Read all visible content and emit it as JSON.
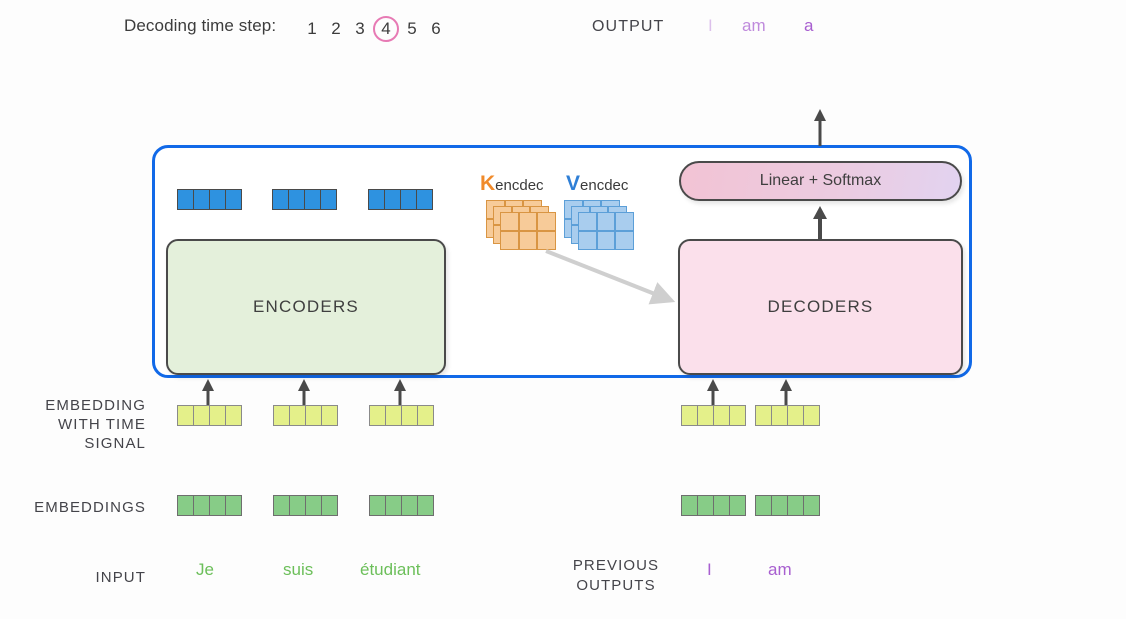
{
  "header": {
    "timestep_label": "Decoding time step:",
    "steps": [
      "1",
      "2",
      "3",
      "4",
      "5",
      "6"
    ],
    "active_step": "4",
    "output_label": "OUTPUT",
    "output_words": [
      {
        "text": "I",
        "opacity": 0.38
      },
      {
        "text": "am",
        "opacity": 0.72
      },
      {
        "text": "a",
        "opacity": 1.0
      }
    ]
  },
  "model": {
    "encoders_label": "ENCODERS",
    "decoders_label": "DECODERS",
    "softmax_label": "Linear + Softmax",
    "attention": {
      "k_cap": "K",
      "k_sub": "encdec",
      "v_cap": "V",
      "v_sub": "encdec"
    }
  },
  "side_labels": {
    "embedding_time_signal": [
      "EMBEDDING",
      "WITH TIME",
      "SIGNAL"
    ],
    "embeddings": "EMBEDDINGS",
    "input": "INPUT",
    "previous_outputs": [
      "PREVIOUS",
      "OUTPUTS"
    ]
  },
  "input_words": [
    "Je",
    "suis",
    "étudiant"
  ],
  "previous_output_words": [
    "I",
    "am"
  ],
  "vectors": {
    "encoder_output_cells": 4,
    "embedding_cells": 4,
    "time_signal_cells": 4,
    "encoder_columns": 3,
    "decoder_columns": 2
  },
  "colors": {
    "container_border": "#1169e8",
    "encoder_fill": "#e4f0db",
    "decoder_fill": "#fbe0eb",
    "k_accent": "#f08a2a",
    "v_accent": "#2f7fd6",
    "active_step_ring": "#e77ab4",
    "input_word": "#6cbf5a",
    "output_word": "#a85fd0",
    "encoder_vector": "#2e92e0",
    "time_signal_vector": "#e4f08a",
    "embedding_vector": "#87cc87"
  }
}
